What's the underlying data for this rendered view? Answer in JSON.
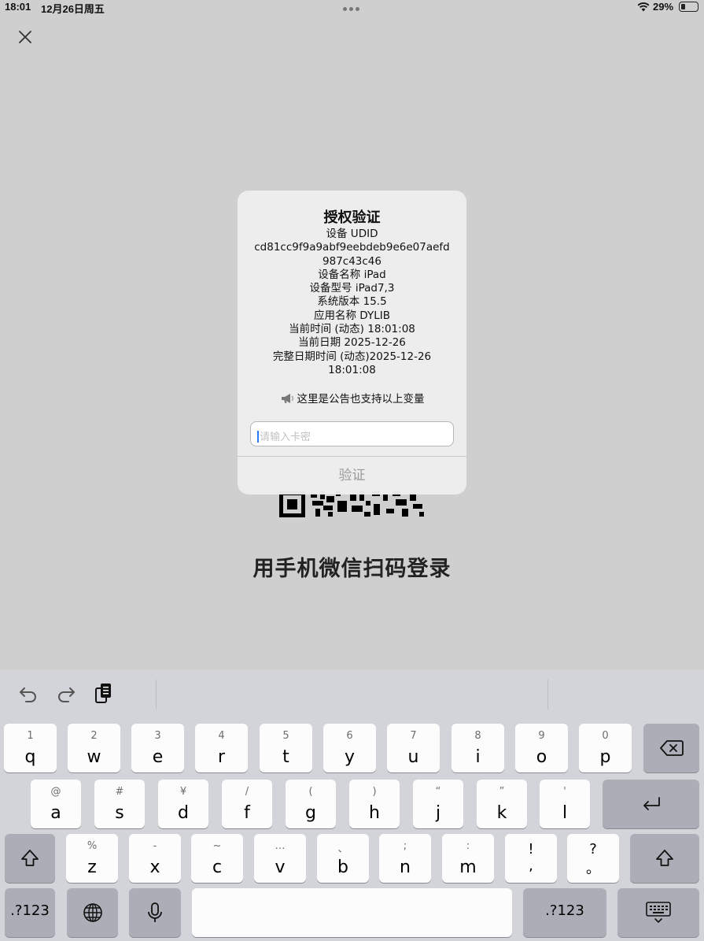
{
  "status": {
    "time": "18:01",
    "date": "12月26日周五",
    "battery_pct": "29%"
  },
  "background": {
    "login_text": "用手机微信扫码登录"
  },
  "dialog": {
    "title": "授权验证",
    "lines": [
      "设备 UDID",
      "cd81cc9f9a9abf9eebdeb9e6e07aefd",
      "987c43c46",
      "设备名称 iPad",
      "设备型号 iPad7,3",
      "系统版本 15.5",
      "应用名称 DYLIB",
      "当前时间 (动态) 18:01:08",
      "当前日期 2025-12-26",
      "完整日期时间 (动态)2025-12-26",
      "18:01:08"
    ],
    "notice": "这里是公告也支持以上变量",
    "input_placeholder": "请输入卡密",
    "verify_label": "验证"
  },
  "keyboard": {
    "row1": [
      {
        "hint": "1",
        "key": "q"
      },
      {
        "hint": "2",
        "key": "w"
      },
      {
        "hint": "3",
        "key": "e"
      },
      {
        "hint": "4",
        "key": "r"
      },
      {
        "hint": "5",
        "key": "t"
      },
      {
        "hint": "6",
        "key": "y"
      },
      {
        "hint": "7",
        "key": "u"
      },
      {
        "hint": "8",
        "key": "i"
      },
      {
        "hint": "9",
        "key": "o"
      },
      {
        "hint": "0",
        "key": "p"
      }
    ],
    "row2": [
      {
        "hint": "@",
        "key": "a"
      },
      {
        "hint": "#",
        "key": "s"
      },
      {
        "hint": "¥",
        "key": "d"
      },
      {
        "hint": "/",
        "key": "f"
      },
      {
        "hint": "(",
        "key": "g"
      },
      {
        "hint": ")",
        "key": "h"
      },
      {
        "hint": "“",
        "key": "j"
      },
      {
        "hint": "”",
        "key": "k"
      },
      {
        "hint": "'",
        "key": "l"
      }
    ],
    "row3": [
      {
        "hint": "%",
        "key": "z"
      },
      {
        "hint": "-",
        "key": "x"
      },
      {
        "hint": "~",
        "key": "c"
      },
      {
        "hint": "…",
        "key": "v"
      },
      {
        "hint": "、",
        "key": "b"
      },
      {
        "hint": ";",
        "key": "n"
      },
      {
        "hint": ":",
        "key": "m"
      }
    ],
    "excl_top": "!",
    "excl_bot": ",",
    "quest_top": "?",
    "quest_bot": "。",
    "numbers_label": ".?123"
  }
}
